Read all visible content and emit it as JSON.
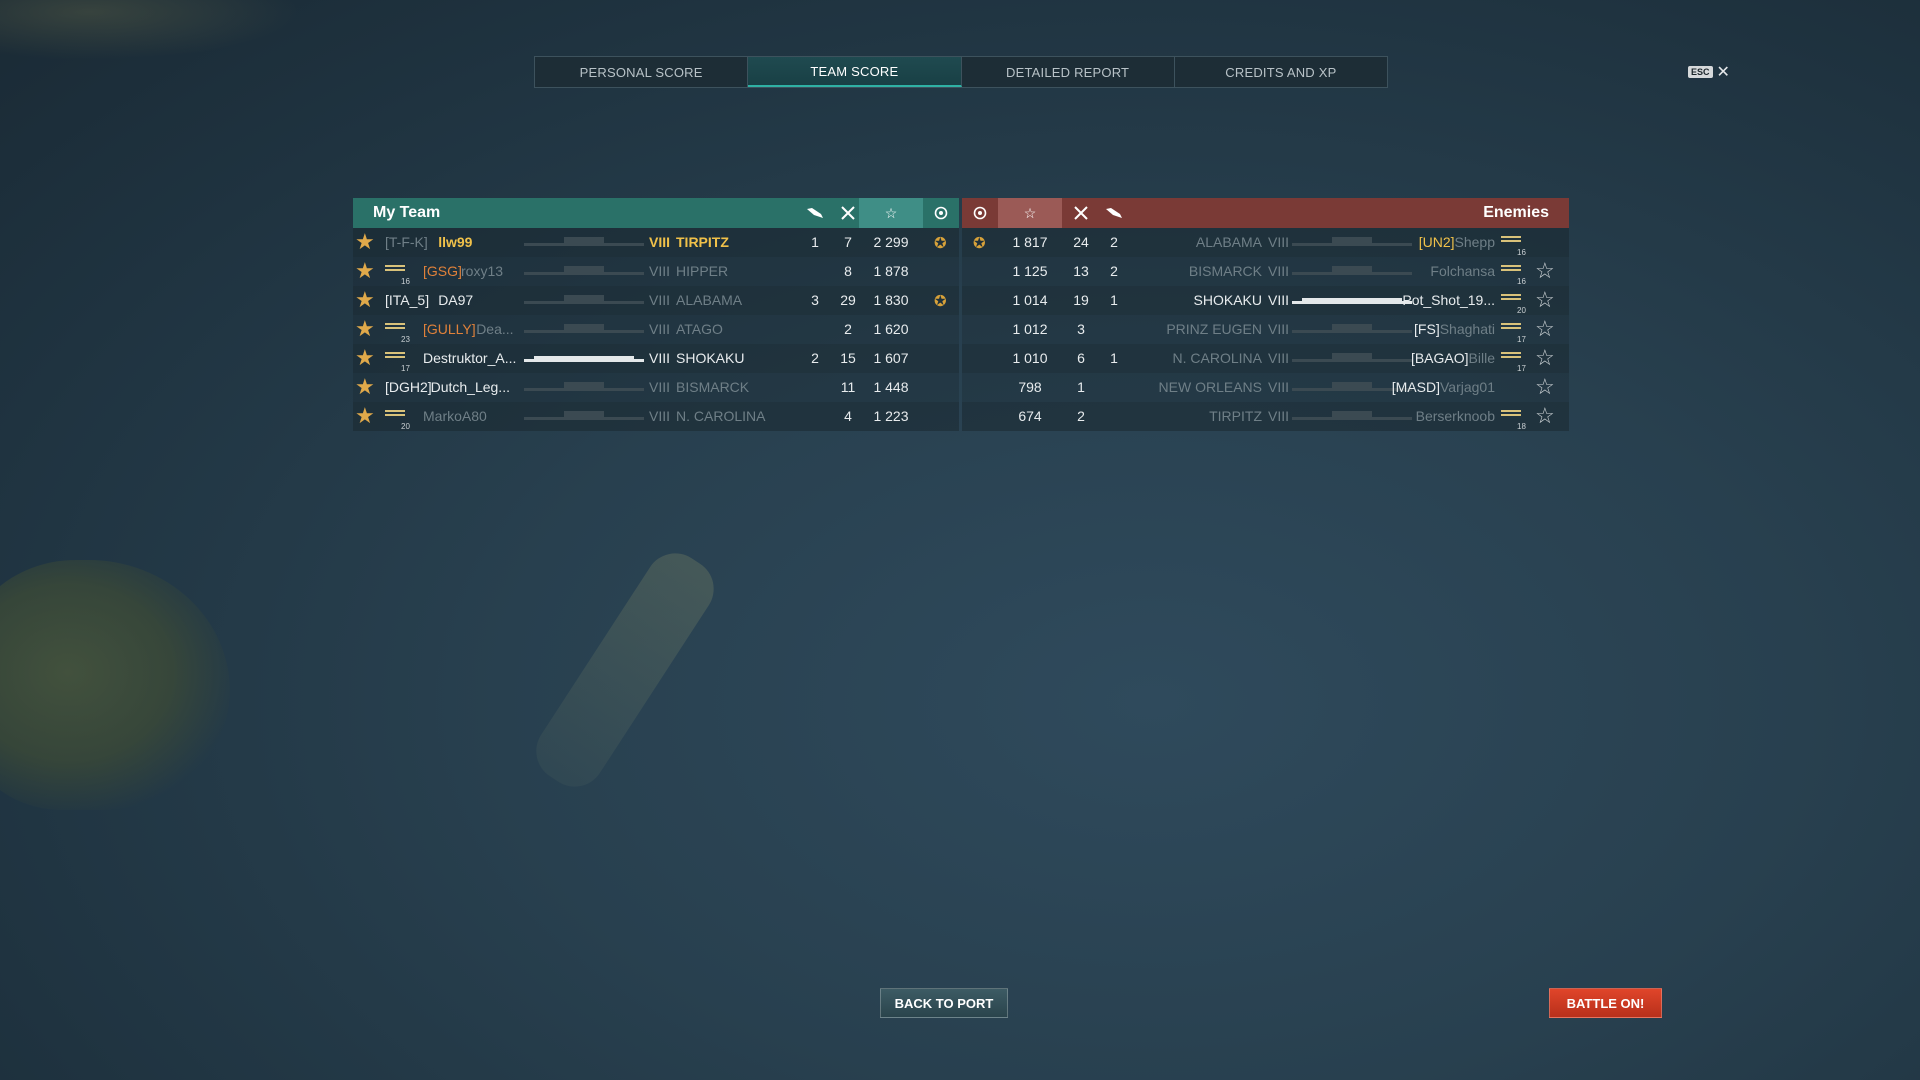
{
  "tabs": [
    "PERSONAL SCORE",
    "TEAM SCORE",
    "DETAILED REPORT",
    "CREDITS AND XP"
  ],
  "active_tab": 1,
  "esc": {
    "key": "ESC",
    "close": "✕"
  },
  "my_team": {
    "title": "My Team",
    "header_icons": [
      "plane-icon",
      "crossed-swords-icon",
      "star-icon",
      "medal-icon"
    ],
    "rows": [
      {
        "clan": "[T-F-K]",
        "name": "llw99",
        "tier": "VIII",
        "ship": "TIRPITZ",
        "planes": "1",
        "kills": "7",
        "xp": "2 299",
        "medal": true,
        "style": "self",
        "rank": "",
        "ship_style": "dark"
      },
      {
        "clan": "[GSG]",
        "name": "roxy13",
        "tier": "VIII",
        "ship": "HIPPER",
        "planes": "",
        "kills": "8",
        "xp": "1 878",
        "medal": false,
        "style": "dead",
        "rank": "16",
        "ship_style": "dark"
      },
      {
        "clan": "[ITA_5]",
        "name": "DA97",
        "tier": "VIII",
        "ship": "ALABAMA",
        "planes": "3",
        "kills": "29",
        "xp": "1 830",
        "medal": true,
        "style": "mixed",
        "rank": "",
        "ship_style": "dark"
      },
      {
        "clan": "[GULLY]",
        "name": "Dea...",
        "tier": "VIII",
        "ship": "ATAGO",
        "planes": "",
        "kills": "2",
        "xp": "1 620",
        "medal": false,
        "style": "dead",
        "rank": "23",
        "ship_style": "dark"
      },
      {
        "clan": "",
        "name": "Destruktor_A...",
        "tier": "VIII",
        "ship": "SHOKAKU",
        "planes": "2",
        "kills": "15",
        "xp": "1 607",
        "medal": false,
        "style": "alive",
        "rank": "17",
        "ship_style": "white"
      },
      {
        "clan": "[DGH2]",
        "name": "Dutch_Leg...",
        "tier": "VIII",
        "ship": "BISMARCK",
        "planes": "",
        "kills": "11",
        "xp": "1 448",
        "medal": false,
        "style": "mixed",
        "rank": "",
        "ship_style": "dark"
      },
      {
        "clan": "",
        "name": "MarkoA80",
        "tier": "VIII",
        "ship": "N. CAROLINA",
        "planes": "",
        "kills": "4",
        "xp": "1 223",
        "medal": false,
        "style": "dead",
        "rank": "20",
        "ship_style": "dark"
      }
    ]
  },
  "enemies": {
    "title": "Enemies",
    "header_icons": [
      "medal-icon",
      "star-icon",
      "crossed-swords-icon",
      "plane-icon"
    ],
    "rows": [
      {
        "clan": "[UN2]",
        "name": "Shepp",
        "tier": "VIII",
        "ship": "ALABAMA",
        "planes": "2",
        "kills": "24",
        "xp": "1 817",
        "medal": true,
        "style": "dead-clan",
        "rank": "16",
        "ship_style": "dark",
        "best": false
      },
      {
        "clan": "",
        "name": "Folchansa",
        "tier": "VIII",
        "ship": "BISMARCK",
        "planes": "2",
        "kills": "13",
        "xp": "1 125",
        "medal": false,
        "style": "dead",
        "rank": "16",
        "ship_style": "dark",
        "best": true
      },
      {
        "clan": "",
        "name": "Pot_Shot_19...",
        "tier": "VIII",
        "ship": "SHOKAKU",
        "planes": "1",
        "kills": "19",
        "xp": "1 014",
        "medal": false,
        "style": "alive",
        "rank": "20",
        "ship_style": "white",
        "best": true
      },
      {
        "clan": "[FS]",
        "name": "Shaghati",
        "tier": "VIII",
        "ship": "PRINZ EUGEN",
        "planes": "",
        "kills": "3",
        "xp": "1 012",
        "medal": false,
        "style": "mixed",
        "rank": "17",
        "ship_style": "dark",
        "best": true
      },
      {
        "clan": "[BAGAO]",
        "name": "Bille",
        "tier": "VIII",
        "ship": "N. CAROLINA",
        "planes": "1",
        "kills": "6",
        "xp": "1 010",
        "medal": false,
        "style": "mixed",
        "rank": "17",
        "ship_style": "dark",
        "best": true
      },
      {
        "clan": "[MASD]",
        "name": "Varjag01",
        "tier": "VIII",
        "ship": "NEW ORLEANS",
        "planes": "",
        "kills": "1",
        "xp": "798",
        "medal": false,
        "style": "mixed",
        "rank": "",
        "ship_style": "dark",
        "best": true
      },
      {
        "clan": "",
        "name": "Berserknoob",
        "tier": "VIII",
        "ship": "TIRPITZ",
        "planes": "",
        "kills": "2",
        "xp": "674",
        "medal": false,
        "style": "dead",
        "rank": "18",
        "ship_style": "dark",
        "best": true
      }
    ]
  },
  "buttons": {
    "back": "BACK TO PORT",
    "battle": "BATTLE ON!"
  },
  "colors": {
    "team": "#2a7168",
    "enemy": "#7a3a36",
    "gold": "#f0c14a",
    "battle": "#d23c22"
  }
}
